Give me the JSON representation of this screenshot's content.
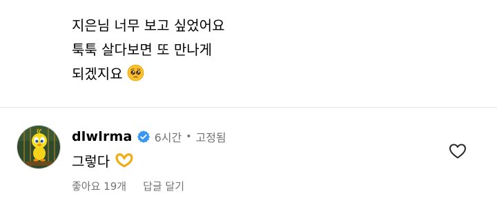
{
  "previous_comment": {
    "lines": [
      "지은님 너무 보고 싶었어요",
      "툭툭 살다보면 또 만나게",
      "되겠지요"
    ],
    "trailing_emoji": "pleading-face-icon"
  },
  "comment": {
    "username": "dlwlrma",
    "verified_icon": "verified-badge-icon",
    "time": "6시간",
    "separator": "•",
    "pinned": "고정됨",
    "text": "그렇다",
    "text_emoji": "heart-hands-icon",
    "likes_label": "좋아요 19개",
    "reply_label": "답글 달기",
    "like_icon": "heart-outline-icon"
  },
  "colors": {
    "verified_blue": "#3897f0",
    "secondary_text": "#737373",
    "divider": "#e6e6e6",
    "emoji_yellow": "#fbc02d"
  }
}
